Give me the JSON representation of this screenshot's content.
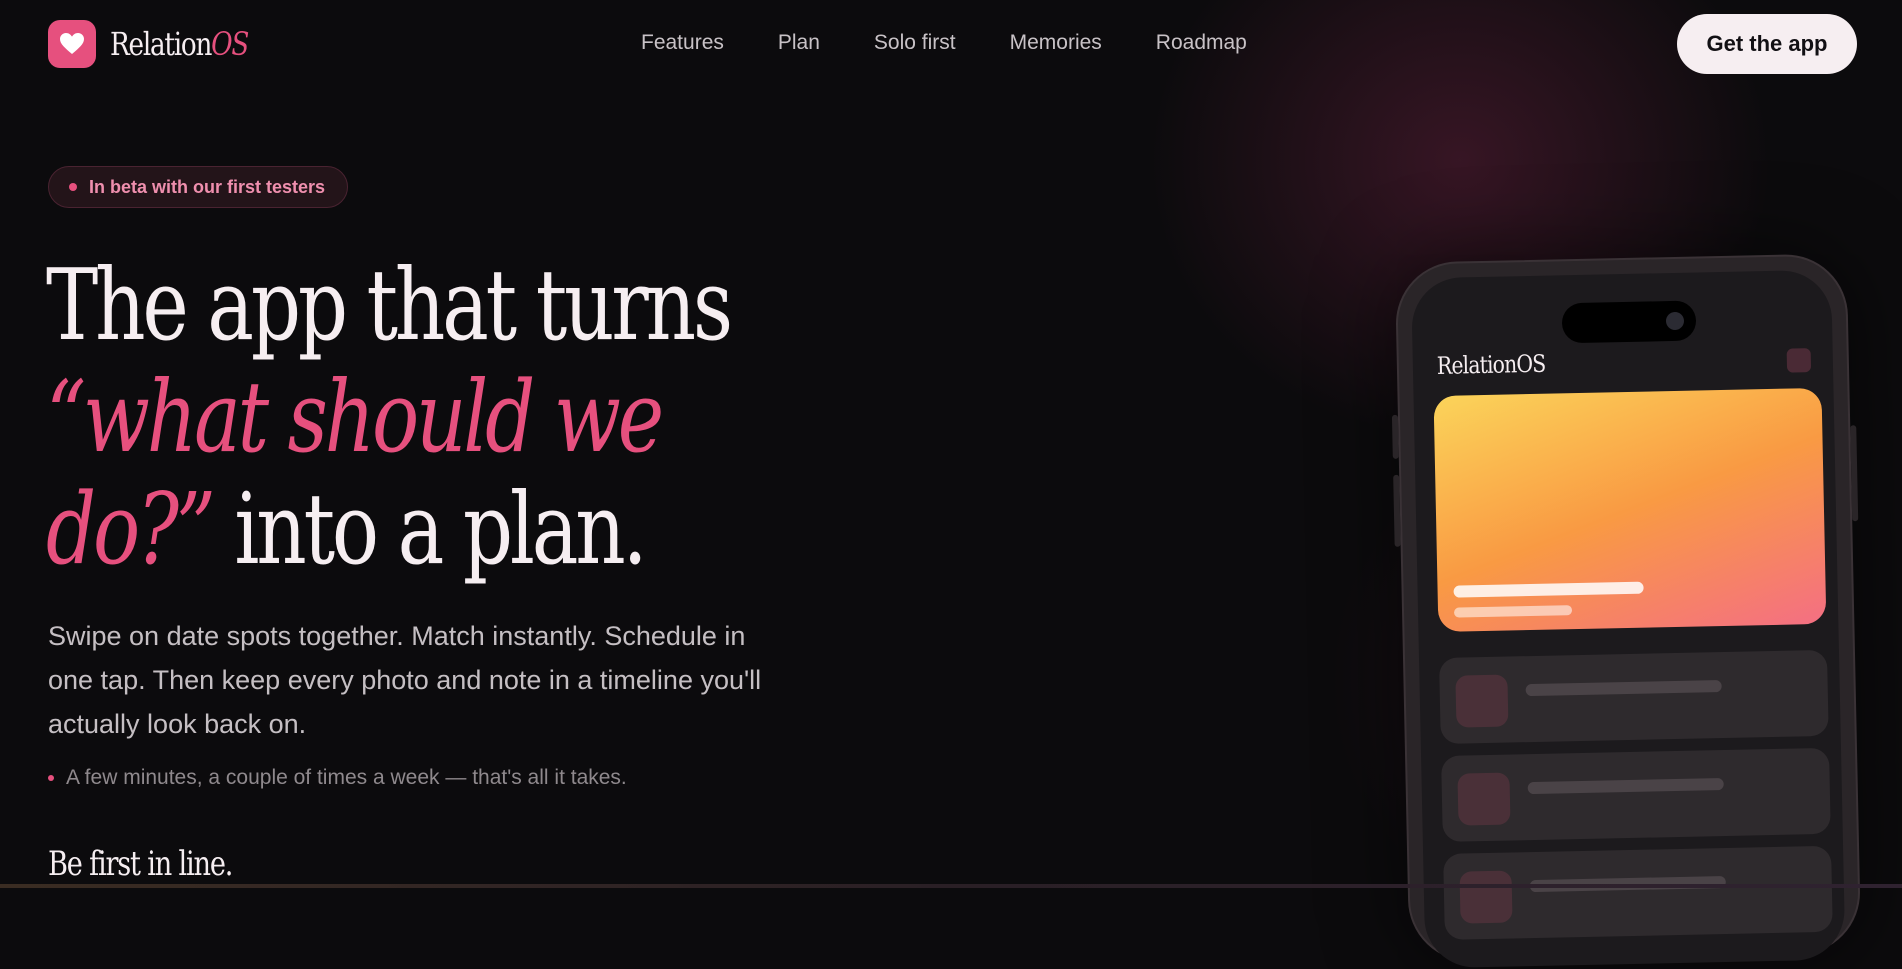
{
  "brand": {
    "name_main": "Relation",
    "name_accent": "OS"
  },
  "nav": {
    "items": [
      {
        "label": "Features"
      },
      {
        "label": "Plan"
      },
      {
        "label": "Solo first"
      },
      {
        "label": "Memories"
      },
      {
        "label": "Roadmap"
      }
    ],
    "cta_label": "Get the app"
  },
  "hero": {
    "badge": "In beta with our first testers",
    "headline_line1": "The app that turns",
    "headline_accent_1": "“what should we",
    "headline_accent_2": "do?”",
    "headline_tail": " into a plan.",
    "subtitle": "Swipe on date spots together. Match instantly. Schedule in one tap. Then keep every photo and note in a timeline you'll actually look back on.",
    "note": "A few minutes, a couple of times a week — that's all it takes.",
    "section_heading": "Be first in line."
  },
  "phone": {
    "app_title": "RelationOS"
  },
  "colors": {
    "accent": "#e6507e",
    "background": "#0c0b0d",
    "cta_bg": "#f6eef1"
  },
  "icons": {
    "logo": "heart-icon"
  }
}
